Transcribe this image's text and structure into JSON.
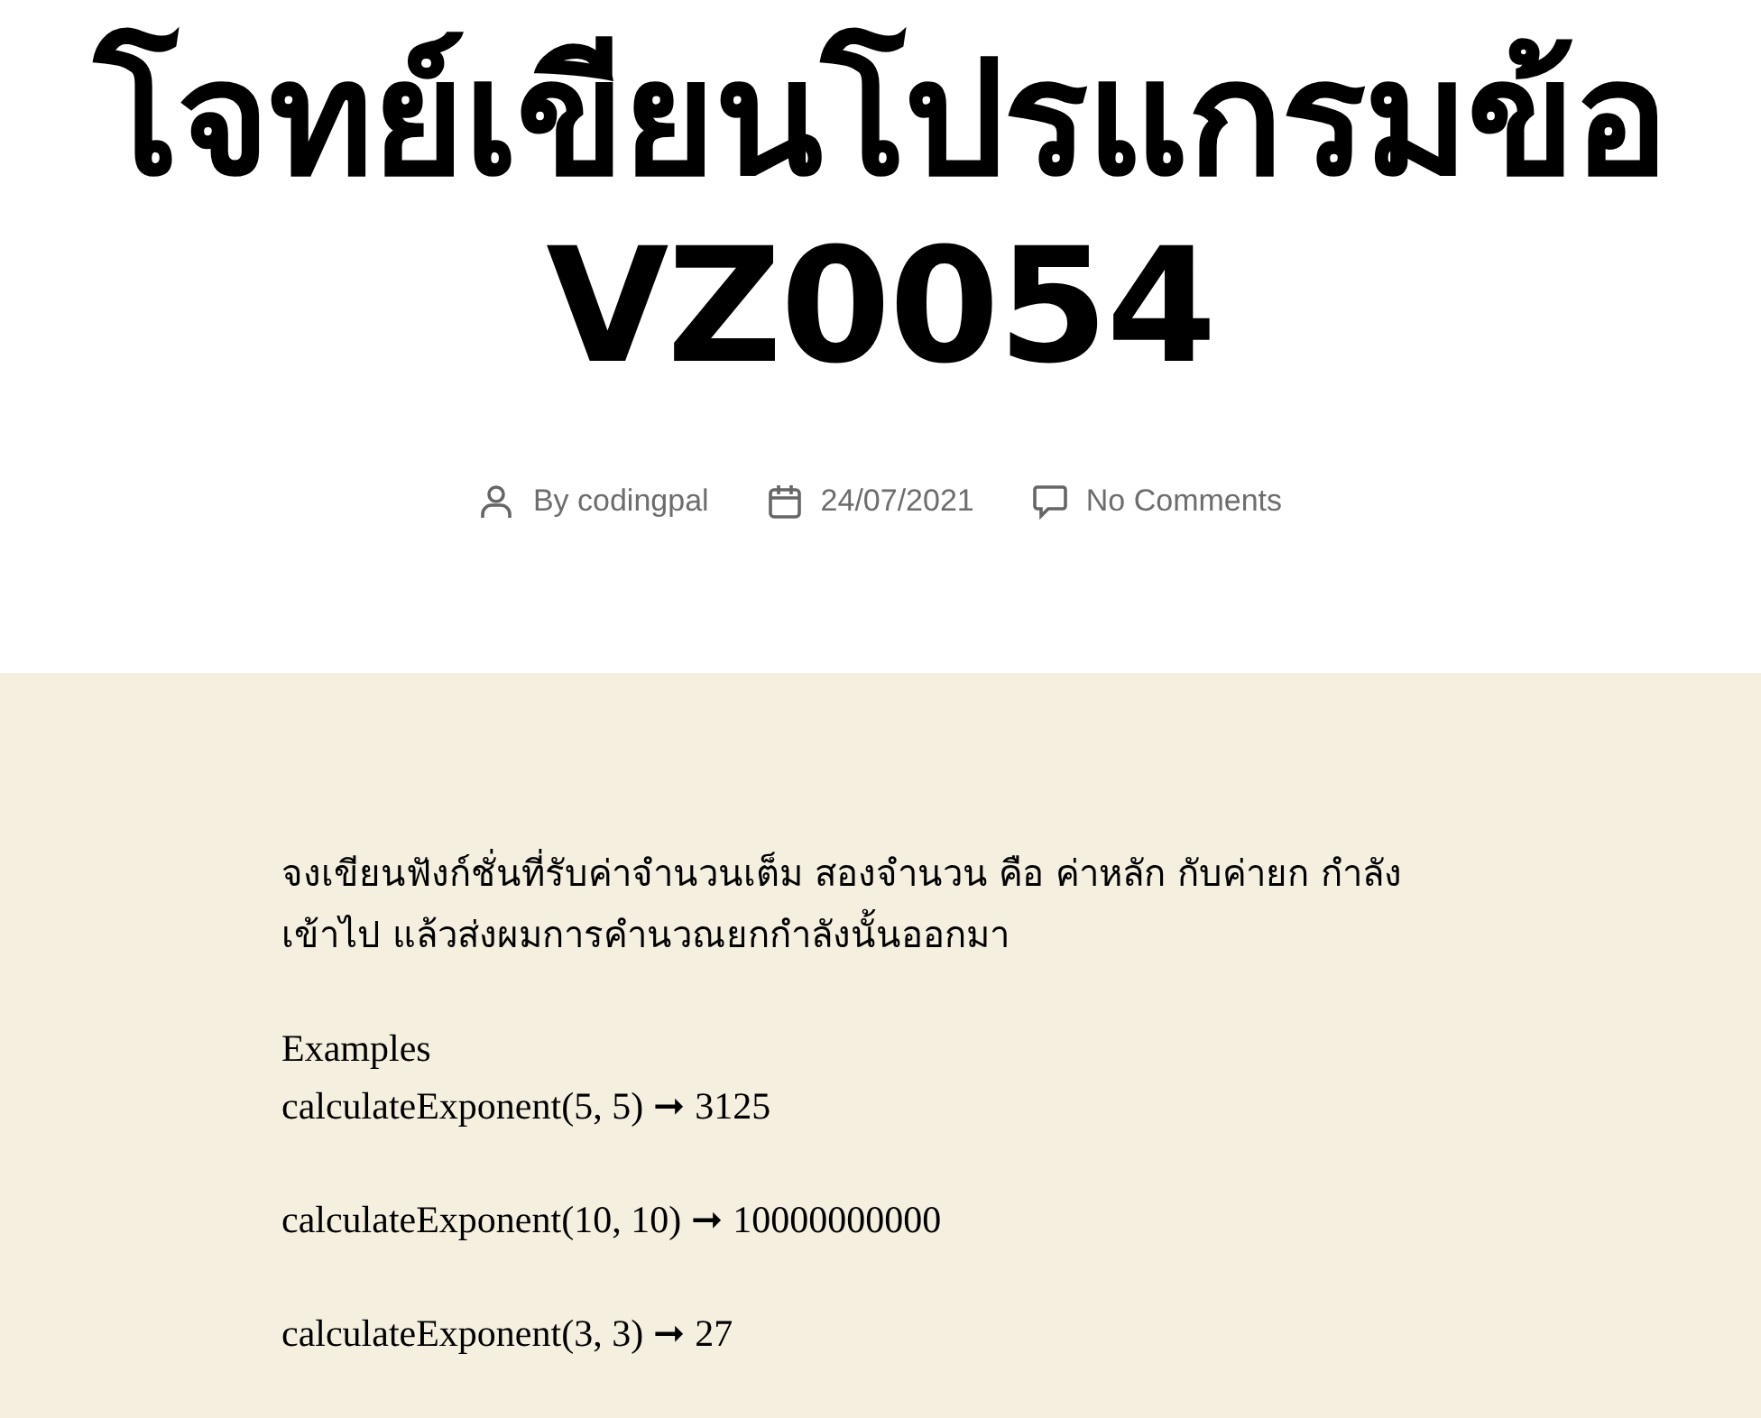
{
  "title": "โจทย์เขียนโปรแกรมข้อ VZ0054",
  "meta": [
    {
      "kind": "author",
      "text": "By codingpal"
    },
    {
      "kind": "date",
      "text": "24/07/2021"
    },
    {
      "kind": "comments",
      "text": "No Comments"
    }
  ],
  "content": {
    "description": "จงเขียนฟังก์ชั่นที่รับค่าจำนวนเต็ม สองจำนวน คือ ค่าหลัก กับค่ายก กำลังเข้าไป แล้วส่งผมการคำนวณยกกำลังนั้นออกมา",
    "examples_heading": "Examples",
    "examples": [
      "calculateExponent(5, 5) ➞ 3125",
      "calculateExponent(10, 10) ➞ 10000000000",
      "calculateExponent(3, 3) ➞ 27"
    ]
  }
}
